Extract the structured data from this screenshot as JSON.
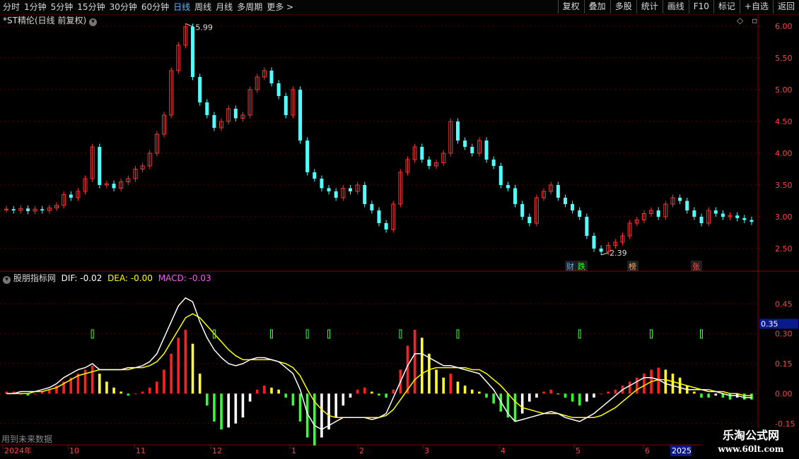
{
  "toolbar": {
    "periods": [
      "分时",
      "1分钟",
      "5分钟",
      "15分钟",
      "30分钟",
      "60分钟",
      "日线",
      "周线",
      "月线",
      "多周期",
      "更多 >"
    ],
    "active": "日线",
    "right": [
      "复权",
      "叠加",
      "多股",
      "统计",
      "画线",
      "F10",
      "标记",
      "+自选",
      "返回"
    ]
  },
  "price_pane": {
    "title": "*ST精伦(日线 前复权)",
    "high_label": "5.99",
    "low_label": "2.39",
    "y_ticks": [
      "6.00",
      "5.50",
      "5.00",
      "4.50",
      "4.00",
      "3.50",
      "3.00",
      "2.50"
    ],
    "markers": [
      {
        "text": "财",
        "color": "#5fb3ff"
      },
      {
        "text": "跌",
        "color": "#33ff33"
      },
      {
        "text": "榜",
        "color": "#ffb060"
      },
      {
        "text": "张",
        "color": "#ff5555"
      }
    ]
  },
  "indicator_pane": {
    "name": "股朋指标网",
    "dif": "DIF: -0.02",
    "dea": "DEA: -0.00",
    "macd": "MACD: -0.03",
    "y_ticks": [
      "0.45",
      "0.30",
      "0.15",
      "0.00",
      "-0.15"
    ],
    "current_value": "0.35",
    "note": "用到未来数据"
  },
  "x_axis": {
    "labels": [
      "2024年",
      "10",
      "11",
      "12",
      "1",
      "2",
      "3",
      "4",
      "5",
      "6",
      "2025"
    ]
  },
  "watermark": {
    "line1": "乐淘公式网",
    "line2": "www.60lt.com"
  },
  "colors": {
    "up": "#ff3333",
    "down": "#54ffff",
    "dif": "#ffffff",
    "dea": "#ffff00",
    "grid": "#5a0000"
  },
  "chart_data": [
    {
      "type": "candlestick",
      "title": "*ST精伦(日线 前复权)",
      "ylim": [
        2.3,
        6.1
      ],
      "series": [
        {
          "name": "close",
          "values": [
            3.12,
            3.1,
            3.13,
            3.09,
            3.12,
            3.1,
            3.14,
            3.18,
            3.35,
            3.3,
            3.4,
            3.6,
            4.1,
            3.5,
            3.52,
            3.45,
            3.55,
            3.6,
            3.75,
            3.8,
            4.0,
            4.3,
            4.6,
            5.3,
            5.7,
            5.99,
            5.2,
            4.8,
            4.6,
            4.4,
            4.5,
            4.7,
            4.55,
            4.6,
            5.0,
            5.2,
            5.3,
            5.1,
            4.9,
            4.6,
            5.0,
            4.2,
            3.7,
            3.6,
            3.45,
            3.4,
            3.3,
            3.45,
            3.4,
            3.5,
            3.2,
            3.1,
            2.9,
            2.8,
            3.2,
            3.7,
            3.9,
            4.1,
            3.9,
            3.8,
            3.85,
            4.0,
            4.5,
            4.2,
            4.1,
            4.0,
            4.2,
            3.9,
            3.8,
            3.5,
            3.45,
            3.2,
            3.0,
            2.9,
            3.3,
            3.4,
            3.5,
            3.3,
            3.2,
            3.1,
            3.0,
            2.7,
            2.5,
            2.45,
            2.55,
            2.6,
            2.7,
            2.9,
            2.95,
            3.05,
            3.1,
            3.0,
            3.2,
            3.3,
            3.25,
            3.1,
            3.0,
            2.9,
            3.1,
            3.05,
            3.0,
            3.02,
            2.98,
            2.95,
            2.92
          ]
        }
      ]
    },
    {
      "type": "bar",
      "title": "股朋指标网",
      "ylim": [
        -0.25,
        0.55
      ],
      "series": [
        {
          "name": "MACD",
          "values": [
            0.01,
            0.01,
            0.0,
            -0.01,
            0.0,
            0.01,
            0.02,
            0.04,
            0.06,
            0.08,
            0.1,
            0.12,
            0.14,
            0.1,
            0.06,
            0.03,
            0.01,
            -0.01,
            0.0,
            0.01,
            0.03,
            0.06,
            0.12,
            0.2,
            0.28,
            0.32,
            0.25,
            0.1,
            -0.06,
            -0.14,
            -0.18,
            -0.17,
            -0.15,
            -0.12,
            -0.04,
            0.02,
            0.04,
            0.03,
            0.02,
            -0.02,
            -0.06,
            -0.14,
            -0.22,
            -0.26,
            -0.22,
            -0.18,
            -0.12,
            -0.06,
            -0.02,
            0.02,
            0.03,
            0.01,
            -0.01,
            -0.02,
            0.02,
            0.12,
            0.24,
            0.32,
            0.28,
            0.2,
            0.12,
            0.08,
            0.1,
            0.06,
            0.04,
            0.02,
            0.01,
            -0.02,
            -0.05,
            -0.09,
            -0.12,
            -0.14,
            -0.1,
            -0.04,
            -0.02,
            0.01,
            0.02,
            0.0,
            -0.02,
            -0.04,
            -0.06,
            -0.04,
            -0.02,
            0.0,
            0.01,
            0.02,
            0.04,
            0.06,
            0.08,
            0.1,
            0.12,
            0.13,
            0.12,
            0.1,
            0.08,
            0.04,
            0.01,
            -0.02,
            -0.02,
            -0.01,
            -0.02,
            -0.03,
            -0.02,
            -0.03,
            -0.03
          ]
        },
        {
          "name": "DIF",
          "values": [
            0.0,
            0.0,
            0.01,
            0.01,
            0.01,
            0.02,
            0.03,
            0.05,
            0.08,
            0.1,
            0.12,
            0.13,
            0.15,
            0.12,
            0.12,
            0.12,
            0.12,
            0.13,
            0.13,
            0.14,
            0.16,
            0.2,
            0.28,
            0.36,
            0.44,
            0.48,
            0.46,
            0.36,
            0.28,
            0.22,
            0.18,
            0.15,
            0.14,
            0.15,
            0.17,
            0.18,
            0.18,
            0.17,
            0.16,
            0.13,
            0.1,
            0.02,
            -0.1,
            -0.16,
            -0.18,
            -0.16,
            -0.14,
            -0.12,
            -0.12,
            -0.12,
            -0.12,
            -0.13,
            -0.12,
            -0.1,
            -0.02,
            0.06,
            0.14,
            0.2,
            0.2,
            0.18,
            0.16,
            0.14,
            0.14,
            0.13,
            0.12,
            0.11,
            0.1,
            0.06,
            0.02,
            -0.04,
            -0.1,
            -0.14,
            -0.13,
            -0.12,
            -0.11,
            -0.1,
            -0.09,
            -0.1,
            -0.12,
            -0.13,
            -0.14,
            -0.12,
            -0.1,
            -0.07,
            -0.04,
            -0.01,
            0.02,
            0.04,
            0.06,
            0.08,
            0.08,
            0.07,
            0.05,
            0.04,
            0.03,
            0.02,
            0.02,
            0.02,
            0.01,
            0.01,
            0.0,
            -0.01,
            -0.01,
            -0.02,
            -0.02
          ]
        },
        {
          "name": "DEA",
          "values": [
            0.0,
            0.0,
            0.0,
            0.0,
            0.01,
            0.01,
            0.02,
            0.03,
            0.05,
            0.07,
            0.09,
            0.1,
            0.11,
            0.12,
            0.12,
            0.12,
            0.12,
            0.12,
            0.13,
            0.13,
            0.14,
            0.16,
            0.2,
            0.26,
            0.32,
            0.38,
            0.4,
            0.38,
            0.34,
            0.3,
            0.26,
            0.22,
            0.19,
            0.17,
            0.17,
            0.17,
            0.17,
            0.17,
            0.16,
            0.15,
            0.13,
            0.09,
            0.02,
            -0.04,
            -0.08,
            -0.11,
            -0.12,
            -0.12,
            -0.12,
            -0.12,
            -0.12,
            -0.12,
            -0.12,
            -0.11,
            -0.08,
            -0.03,
            0.02,
            0.07,
            0.1,
            0.12,
            0.13,
            0.13,
            0.13,
            0.13,
            0.13,
            0.12,
            0.12,
            0.1,
            0.07,
            0.04,
            0.0,
            -0.04,
            -0.07,
            -0.08,
            -0.09,
            -0.1,
            -0.1,
            -0.1,
            -0.11,
            -0.12,
            -0.12,
            -0.12,
            -0.12,
            -0.11,
            -0.09,
            -0.07,
            -0.04,
            -0.01,
            0.02,
            0.04,
            0.06,
            0.07,
            0.07,
            0.06,
            0.05,
            0.04,
            0.03,
            0.02,
            0.02,
            0.01,
            0.01,
            0.0,
            0.0,
            -0.01,
            -0.01
          ]
        }
      ]
    }
  ]
}
